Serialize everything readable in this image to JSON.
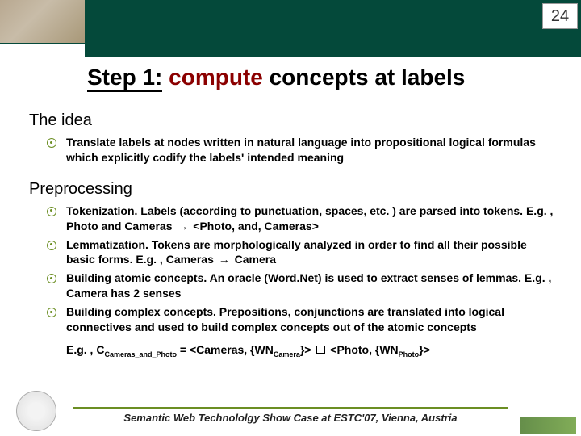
{
  "page_number": "24",
  "title_prefix": "Step 1:",
  "title_accent": "compute",
  "title_rest": "concepts at labels",
  "sections": {
    "idea": {
      "heading": "The idea",
      "bullet": "Translate labels at nodes written in natural language into propositional logical formulas which explicitly codify the labels' intended meaning"
    },
    "preprocessing": {
      "heading": "Preprocessing",
      "b1_a": "Tokenization. Labels (according to punctuation, spaces, etc. ) are parsed into tokens. E.g. , Photo and Cameras ",
      "b1_b": " <Photo, and, Cameras>",
      "b2_a": "Lemmatization. Tokens are morphologically analyzed in order to find all their possible basic forms. E.g. , Cameras ",
      "b2_b": " Camera",
      "b3": "Building atomic concepts. An oracle (Word.Net) is used to extract senses of lemmas. E.g. , Camera has 2 senses",
      "b4": "Building complex concepts. Prepositions, conjunctions are translated into logical connectives and used to build complex concepts out of the atomic concepts",
      "example_pre": "E.g. , C",
      "example_sub1": "Cameras_and_Photo",
      "example_mid1": "  =  <Cameras, {WN",
      "example_sub2": "Camera",
      "example_mid2": "}> ",
      "example_mid3": " <Photo, {WN",
      "example_sub3": "Photo",
      "example_end": "}>"
    }
  },
  "arrow_glyph": "→",
  "footer": "Semantic Web Technololgy Show Case at ESTC'07, Vienna, Austria"
}
